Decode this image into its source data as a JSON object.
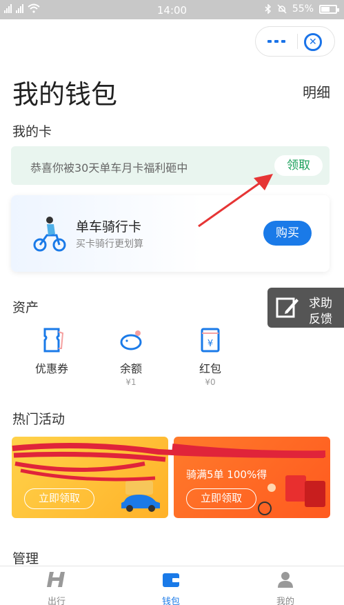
{
  "status_bar": {
    "time": "14:00",
    "battery": "55%",
    "battery_level": 0.55
  },
  "capsule": {
    "more_icon": "more-icon",
    "close_icon": "close-target-icon"
  },
  "header": {
    "title": "我的钱包",
    "detail": "明细"
  },
  "my_cards": {
    "section_title": "我的卡",
    "promo_text": "恭喜你被30天单车月卡福利砸中",
    "promo_button": "领取",
    "ride_card": {
      "title": "单车骑行卡",
      "subtitle": "买卡骑行更划算",
      "button": "购买"
    }
  },
  "feedback": {
    "line1": "求助",
    "line2": "反馈"
  },
  "assets": {
    "section_title": "资产",
    "items": [
      {
        "label": "优惠券",
        "value": "",
        "icon": "coupon-icon"
      },
      {
        "label": "余额",
        "value": "¥1",
        "icon": "piggy-bank-icon"
      },
      {
        "label": "红包",
        "value": "¥0",
        "icon": "red-envelope-icon"
      }
    ]
  },
  "activities": {
    "section_title": "热门活动",
    "cards": [
      {
        "button": "立即领取"
      },
      {
        "subtitle": "骑满5单 100%得",
        "button": "立即领取"
      }
    ]
  },
  "manage": {
    "section_title": "管理"
  },
  "tabbar": {
    "items": [
      {
        "label": "出行",
        "icon": "hello-logo-icon"
      },
      {
        "label": "钱包",
        "icon": "wallet-icon"
      },
      {
        "label": "我的",
        "icon": "user-icon"
      }
    ],
    "active_index": 1
  },
  "colors": {
    "accent": "#1a7ae8",
    "claim_green": "#19a05a",
    "feedback_bg": "#555555"
  }
}
